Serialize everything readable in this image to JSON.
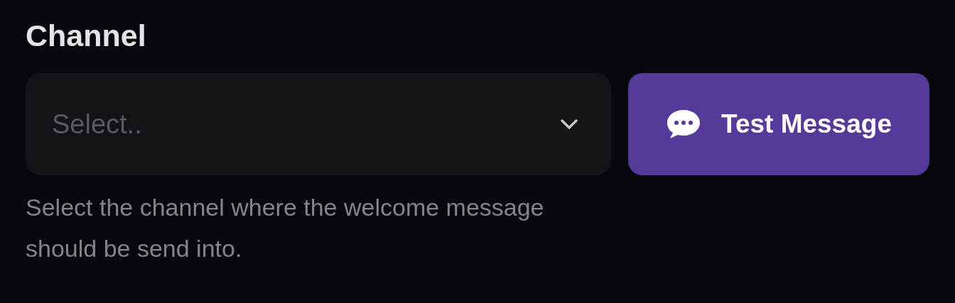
{
  "field": {
    "label": "Channel",
    "select": {
      "placeholder": "Select.."
    },
    "button": {
      "label": "Test Message"
    },
    "help": "Select the channel where the welcome message should be send into."
  }
}
